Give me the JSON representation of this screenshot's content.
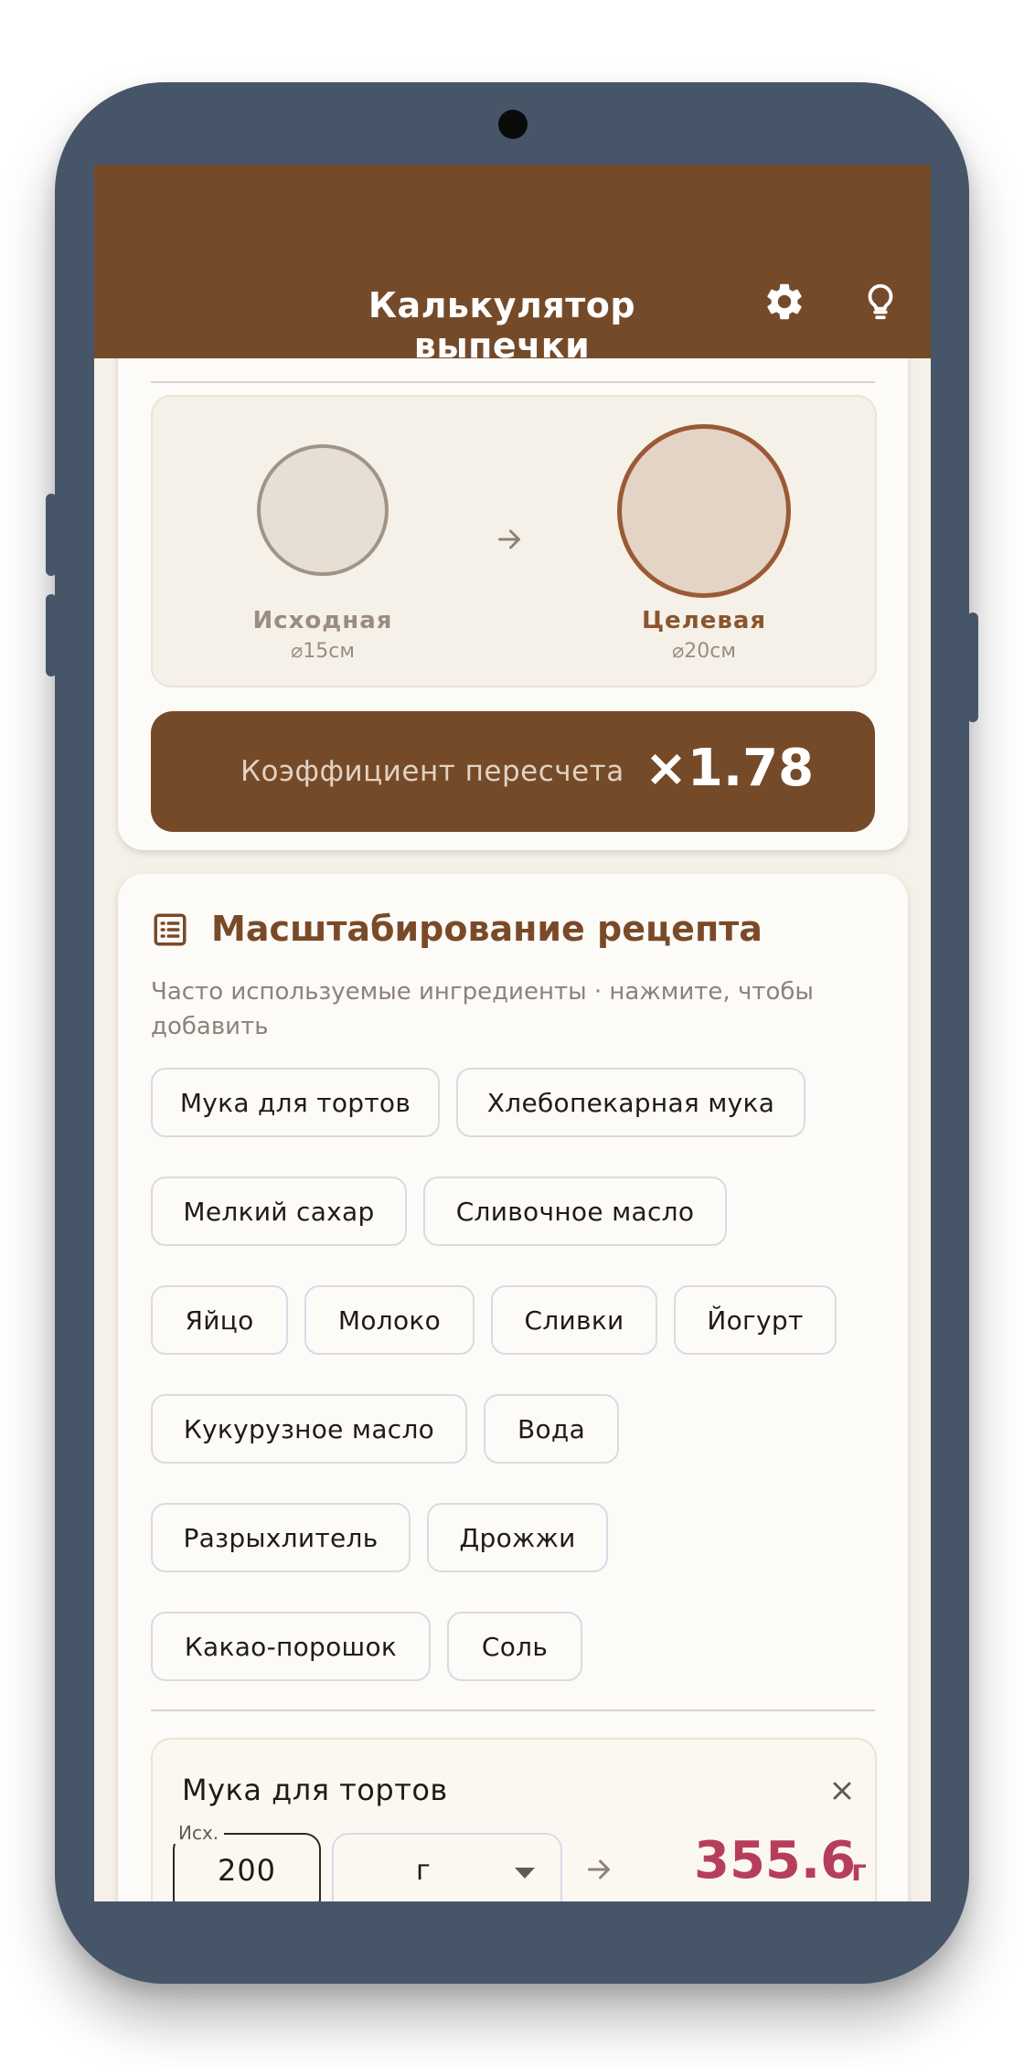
{
  "app": {
    "title": "Калькулятор выпечки",
    "settings_icon": "gear-icon",
    "tips_icon": "lightbulb-icon",
    "header_color": "#754a29"
  },
  "pan_card": {
    "source": {
      "label": "Исходная",
      "size": "⌀15см"
    },
    "target": {
      "label": "Целевая",
      "size": "⌀20см"
    },
    "arrow_icon": "arrow-right-icon",
    "factor_label": "Коэффициент пересчета",
    "factor_value": "×1.78"
  },
  "recipe_card": {
    "icon": "list-icon",
    "title": "Масштабирование рецепта",
    "hint": "Часто используемые ингредиенты · нажмите, чтобы добавить",
    "chips": [
      "Мука для тортов",
      "Хлебопекарная мука",
      "Мелкий сахар",
      "Сливочное масло",
      "Яйцо",
      "Молоко",
      "Сливки",
      "Йогурт",
      "Кукурузное масло",
      "Вода",
      "Разрыхлитель",
      "Дрожжи",
      "Какао-порошок",
      "Соль"
    ],
    "ingredient": {
      "name": "Мука для тортов",
      "source_label": "Исх.",
      "source_value": "200",
      "unit": "г",
      "result_value": "355.6",
      "result_unit": "г",
      "result_color": "#b73e5a"
    }
  }
}
